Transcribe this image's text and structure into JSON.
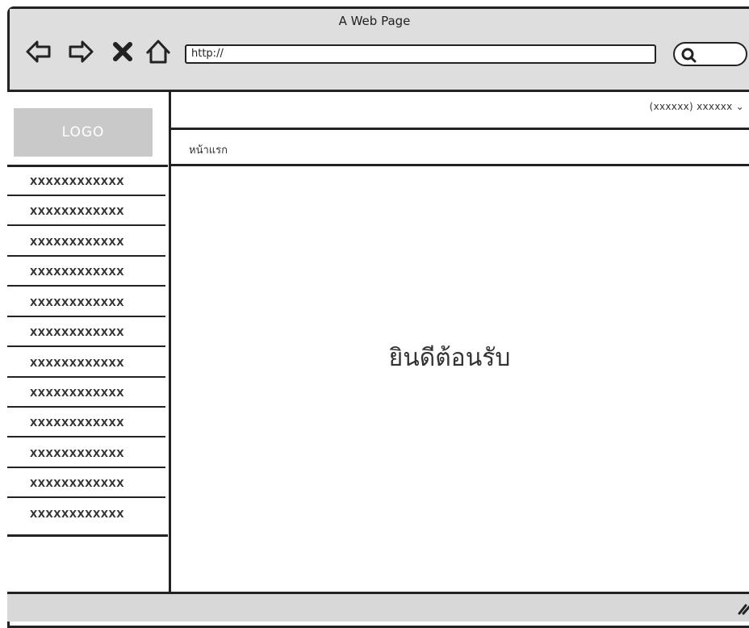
{
  "window": {
    "title": "A Web Page"
  },
  "toolbar": {
    "back_icon": "arrow-left-icon",
    "forward_icon": "arrow-right-icon",
    "stop_icon": "close-icon",
    "home_icon": "home-icon",
    "search_icon": "search-icon"
  },
  "address_bar": {
    "value": "http://"
  },
  "logo": {
    "text": "LOGO"
  },
  "header": {
    "user_menu": "(xxxxxx) xxxxxx ⌄"
  },
  "breadcrumb": {
    "label": "หน้าแรก"
  },
  "sidebar": {
    "items": [
      {
        "label": "XXXXXXXXXXXX"
      },
      {
        "label": "XXXXXXXXXXXX"
      },
      {
        "label": "XXXXXXXXXXXX"
      },
      {
        "label": "XXXXXXXXXXXX"
      },
      {
        "label": "XXXXXXXXXXXX"
      },
      {
        "label": "XXXXXXXXXXXX"
      },
      {
        "label": "XXXXXXXXXXXX"
      },
      {
        "label": "XXXXXXXXXXXX"
      },
      {
        "label": "XXXXXXXXXXXX"
      },
      {
        "label": "XXXXXXXXXXXX"
      },
      {
        "label": "XXXXXXXXXXXX"
      },
      {
        "label": "XXXXXXXXXXXX"
      }
    ]
  },
  "main": {
    "welcome_text": "ยินดีต้อนรับ"
  }
}
